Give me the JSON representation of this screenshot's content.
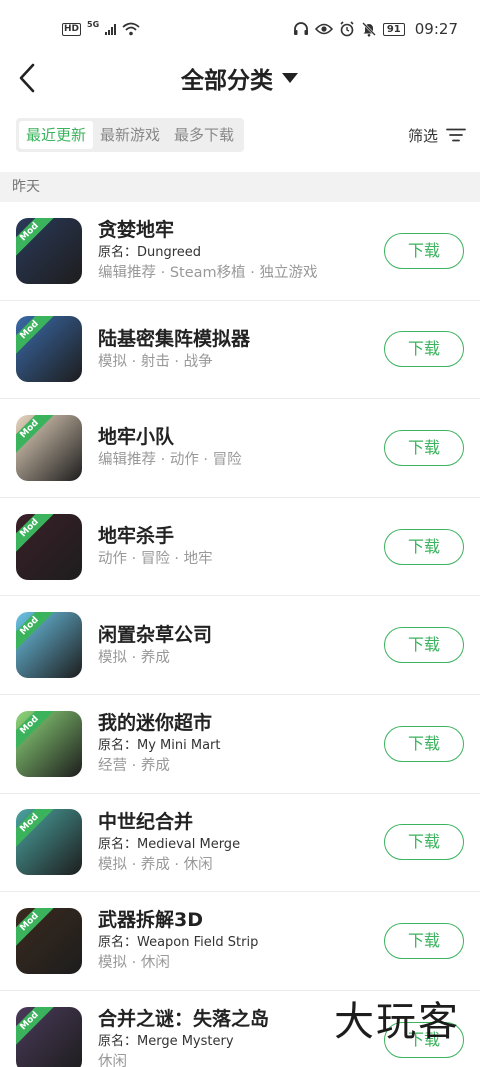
{
  "status": {
    "time": "09:27",
    "battery": "91",
    "hd": "HD",
    "net": "5G"
  },
  "header": {
    "back_icon": "chevron-left-icon",
    "title": "全部分类"
  },
  "tabs": [
    {
      "label": "最近更新",
      "active": true
    },
    {
      "label": "最新游戏",
      "active": false
    },
    {
      "label": "最多下载",
      "active": false
    }
  ],
  "filter_label": "筛选",
  "section_label": "昨天",
  "download_label": "下载",
  "mod_badge": "Mod",
  "apps": [
    {
      "name": "贪婪地牢",
      "orig": "原名：Dungreed",
      "tags": "编辑推荐 · Steam移植 · 独立游戏",
      "icon": "dungreed-icon",
      "bg": "#2a3a5a"
    },
    {
      "name": "陆基密集阵模拟器",
      "orig": "",
      "tags": "模拟 · 射击 · 战争",
      "icon": "ciws-icon",
      "bg": "#3a6aa8"
    },
    {
      "name": "地牢小队",
      "orig": "",
      "tags": "编辑推荐 · 动作 · 冒险",
      "icon": "dungeon-squad-icon",
      "bg": "#e8d6c0"
    },
    {
      "name": "地牢杀手",
      "orig": "",
      "tags": "动作 · 冒险 · 地牢",
      "icon": "dungeon-killer-icon",
      "bg": "#3a2028"
    },
    {
      "name": "闲置杂草公司",
      "orig": "",
      "tags": "模拟 · 养成",
      "icon": "weed-inc-icon",
      "bg": "#6cc4e8"
    },
    {
      "name": "我的迷你超市",
      "orig": "原名：My Mini Mart",
      "tags": "经营 · 养成",
      "icon": "mini-mart-icon",
      "bg": "#8fd87a"
    },
    {
      "name": "中世纪合并",
      "orig": "原名：Medieval Merge",
      "tags": "模拟 · 养成 · 休闲",
      "icon": "medieval-merge-icon",
      "bg": "#4aa4a0"
    },
    {
      "name": "武器拆解3D",
      "orig": "原名：Weapon Field Strip",
      "tags": "模拟 · 休闲",
      "icon": "weapon-strip-icon",
      "bg": "#3a2a1e"
    },
    {
      "name": "合并之谜：失落之岛",
      "orig": "原名：Merge Mystery",
      "tags": "休闲",
      "icon": "merge-mystery-icon",
      "bg": "#4a3a5a"
    }
  ],
  "watermark": "大玩客"
}
